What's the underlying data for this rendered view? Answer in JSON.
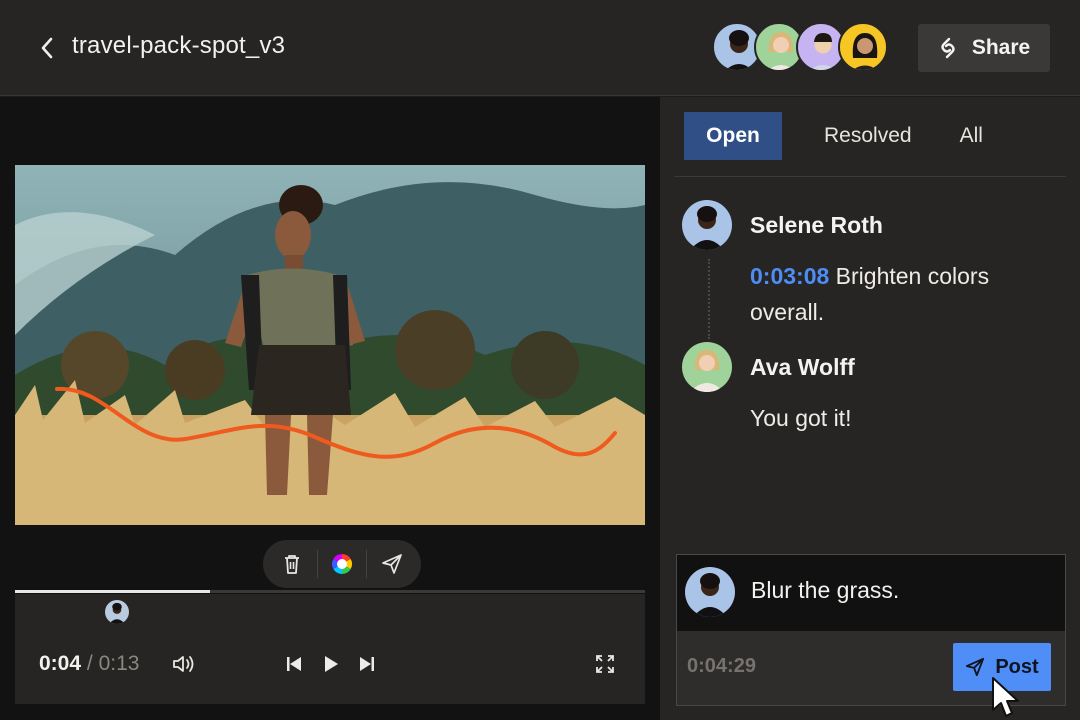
{
  "header": {
    "title": "travel-pack-spot_v3",
    "share_label": "Share",
    "collaborators": [
      "avatar-1",
      "avatar-2",
      "avatar-3",
      "avatar-4"
    ]
  },
  "player": {
    "progress": 0.31,
    "current_time": "0:04",
    "separator": "/",
    "duration": "0:13",
    "tools": [
      "trash-icon",
      "color-wheel-icon",
      "send-icon"
    ],
    "stroke_color": "#ef5a1e"
  },
  "comments_panel": {
    "tabs": [
      {
        "label": "Open",
        "active": true
      },
      {
        "label": "Resolved",
        "active": false
      },
      {
        "label": "All",
        "active": false
      }
    ],
    "comments": [
      {
        "author": "Selene Roth",
        "timestamp": "0:03:08",
        "text": "Brighten colors overall."
      },
      {
        "author": "Ava Wolff",
        "timestamp": "",
        "text": "You got it!"
      }
    ],
    "composer": {
      "text": "Blur the grass.",
      "timestamp": "0:04:29",
      "post_label": "Post"
    }
  },
  "colors": {
    "accent": "#4f8df7",
    "tab_active": "#2f4f86",
    "timestamp_link": "#4e8df5"
  }
}
